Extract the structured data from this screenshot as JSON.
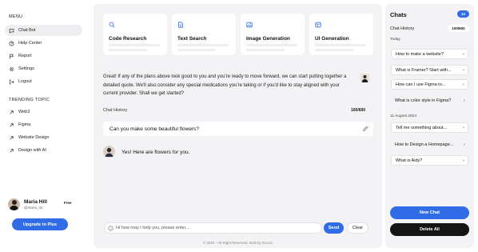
{
  "sidebar": {
    "menu_heading": "MENU",
    "menu_items": [
      {
        "label": "Chat Bot",
        "icon": "chat-bubble-icon"
      },
      {
        "label": "Help Center",
        "icon": "help-circle-icon"
      },
      {
        "label": "Report",
        "icon": "flag-icon"
      },
      {
        "label": "Settings",
        "icon": "gear-icon"
      },
      {
        "label": "Logout",
        "icon": "logout-icon"
      }
    ],
    "trending_heading": "TRENDING TOPIC",
    "trending_items": [
      {
        "label": "Web3",
        "icon": "arrow-up-right-icon"
      },
      {
        "label": "Figma",
        "icon": "arrow-up-right-icon"
      },
      {
        "label": "Website Design",
        "icon": "arrow-up-right-icon"
      },
      {
        "label": "Design with AI",
        "icon": "arrow-up-right-icon"
      }
    ],
    "user": {
      "name": "Maria Hill",
      "handle": "@maria_34",
      "plan": "Free"
    },
    "upgrade_label": "Upgrade to Plus"
  },
  "main": {
    "cards": [
      {
        "title": "Code Research",
        "icon": "search-icon"
      },
      {
        "title": "Text Search",
        "icon": "document-icon"
      },
      {
        "title": "Image Generation",
        "icon": "image-icon"
      },
      {
        "title": "UI Generation",
        "icon": "layout-icon"
      }
    ],
    "intro_text": "Great! If any of the plans above look good to you and you're ready to move forward, we can start putting together a detailed quote. We'll also consider any special medications you're taking or if you'd like to stay aligned with your current provider. Shall we get started?",
    "history_label": "Chat History",
    "history_count": "100/600",
    "question": "Can you make some beautiful flowers?",
    "answer": "Yes! Here are flowers for you.",
    "input_placeholder": "Hi how may I help you, please enter...",
    "send_label": "Send",
    "clear_label": "Clear",
    "footer": "© 2024 - All Right Reserved, Built by Grocic"
  },
  "right_panel": {
    "title": "Chats",
    "chat_count": "12",
    "history_label": "Chat History",
    "history_count": "100/600",
    "groups": [
      {
        "date": "Today",
        "items": [
          {
            "label": "How to make a website?",
            "boxed": true
          },
          {
            "label": "What is Framer? Start with...",
            "boxed": true
          },
          {
            "label": "How can I use Figma to...",
            "boxed": true
          },
          {
            "label": "What is color style in Figma?",
            "boxed": false
          }
        ]
      },
      {
        "date": "11 August 2024",
        "items": [
          {
            "label": "Tell me something about...",
            "boxed": true
          },
          {
            "label": "How to Design a Homepage...",
            "boxed": false
          },
          {
            "label": "What is Aidy?",
            "boxed": true
          }
        ]
      }
    ],
    "new_chat_label": "New Chat",
    "delete_all_label": "Delete All"
  },
  "colors": {
    "accent": "#2f6ce5",
    "panel_bg": "#f3f3f5",
    "dark_button": "#141414"
  }
}
